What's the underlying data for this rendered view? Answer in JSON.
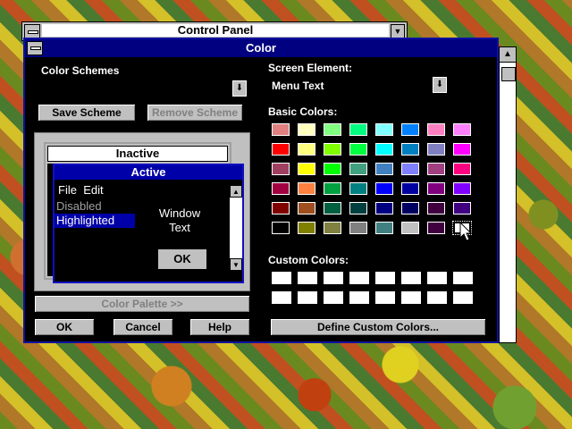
{
  "control_panel": {
    "title": "Control Panel"
  },
  "dialog": {
    "title": "Color",
    "color_schemes_label": "Color Schemes",
    "save_scheme": "Save Scheme",
    "remove_scheme": "Remove Scheme",
    "screen_element_label": "Screen Element:",
    "screen_element_value": "Menu Text",
    "basic_colors_label": "Basic Colors:",
    "custom_colors_label": "Custom Colors:",
    "color_palette": "Color Palette >>",
    "ok": "OK",
    "cancel": "Cancel",
    "help": "Help",
    "define_custom": "Define Custom Colors..."
  },
  "preview": {
    "inactive": "Inactive",
    "active": "Active",
    "menu_file": "File",
    "menu_edit": "Edit",
    "disabled": "Disabled",
    "highlighted": "Highlighted",
    "window_text_1": "Window",
    "window_text_2": "Text",
    "ok": "OK"
  },
  "basic_colors": [
    [
      "#e08080",
      "#ffffc0",
      "#80ff80",
      "#00ff80",
      "#80ffff",
      "#0080ff",
      "#ff80c0",
      "#ff80ff"
    ],
    [
      "#ff0000",
      "#ffff80",
      "#80ff00",
      "#00ff40",
      "#00ffff",
      "#0080c0",
      "#8080c0",
      "#ff00ff"
    ],
    [
      "#a04060",
      "#ffff00",
      "#00ff00",
      "#40a080",
      "#4080c0",
      "#8080ff",
      "#a04080",
      "#ff0080"
    ],
    [
      "#a00040",
      "#ff8040",
      "#00a040",
      "#008080",
      "#0000ff",
      "#0000a0",
      "#800080",
      "#8000ff"
    ],
    [
      "#800000",
      "#a05020",
      "#006040",
      "#004040",
      "#000080",
      "#000060",
      "#400040",
      "#400080"
    ],
    [
      "#000000",
      "#808000",
      "#808040",
      "#808080",
      "#408080",
      "#c0c0c0",
      "#400040",
      "#ffffff"
    ]
  ],
  "selected_color": "#ffffff"
}
